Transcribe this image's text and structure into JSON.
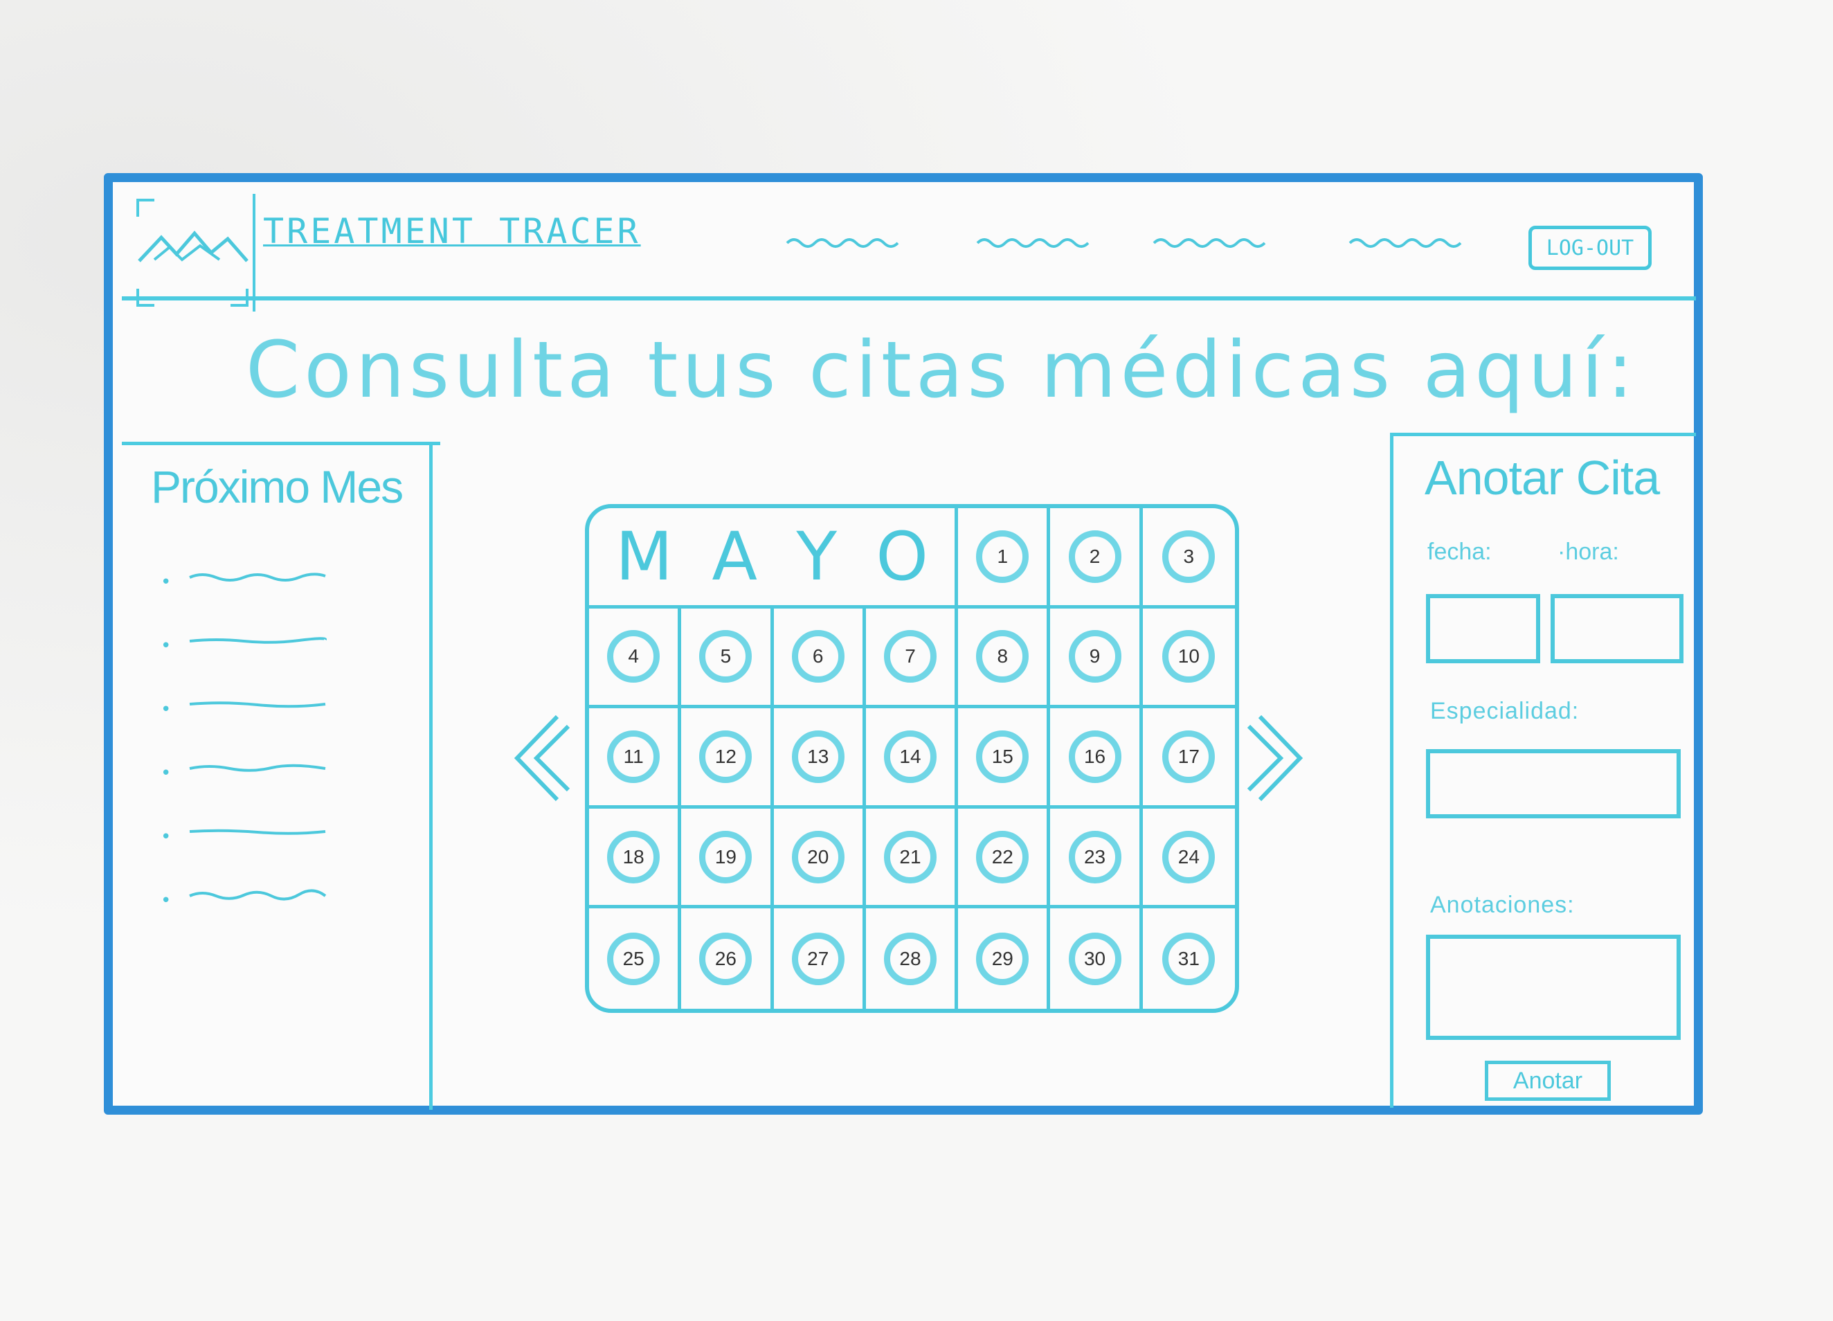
{
  "header": {
    "app_title": "TREATMENT TRACER",
    "logout_label": "LOG-OUT",
    "nav_items": [
      {
        "name": "nav-link-1"
      },
      {
        "name": "nav-link-2"
      },
      {
        "name": "nav-link-3"
      },
      {
        "name": "nav-link-4"
      }
    ],
    "logo_icon": "mountain-logo-icon"
  },
  "main": {
    "title": "Consulta tus citas médicas aquí:"
  },
  "sidebar": {
    "heading": "Próximo Mes",
    "items": [
      "",
      "",
      "",
      "",
      "",
      ""
    ]
  },
  "calendar": {
    "month_letters": [
      "M",
      "A",
      "Y",
      "O"
    ],
    "days": [
      "1",
      "2",
      "3",
      "4",
      "5",
      "6",
      "7",
      "8",
      "9",
      "10",
      "11",
      "12",
      "13",
      "14",
      "15",
      "16",
      "17",
      "18",
      "19",
      "20",
      "21",
      "22",
      "23",
      "24",
      "25",
      "26",
      "27",
      "28",
      "29",
      "30",
      "31"
    ],
    "prev_icon": "chevron-left-icon",
    "next_icon": "chevron-right-icon"
  },
  "appointment_form": {
    "heading": "Anotar Cita",
    "fecha_label": "fecha:",
    "hora_label": "·hora:",
    "especialidad_label": "Especialidad:",
    "anotaciones_label": "Anotaciones:",
    "submit_label": "Anotar"
  },
  "colors": {
    "frame": "#2f8fd8",
    "sketch": "#4cc8dc",
    "circle": "#70d6e6"
  }
}
